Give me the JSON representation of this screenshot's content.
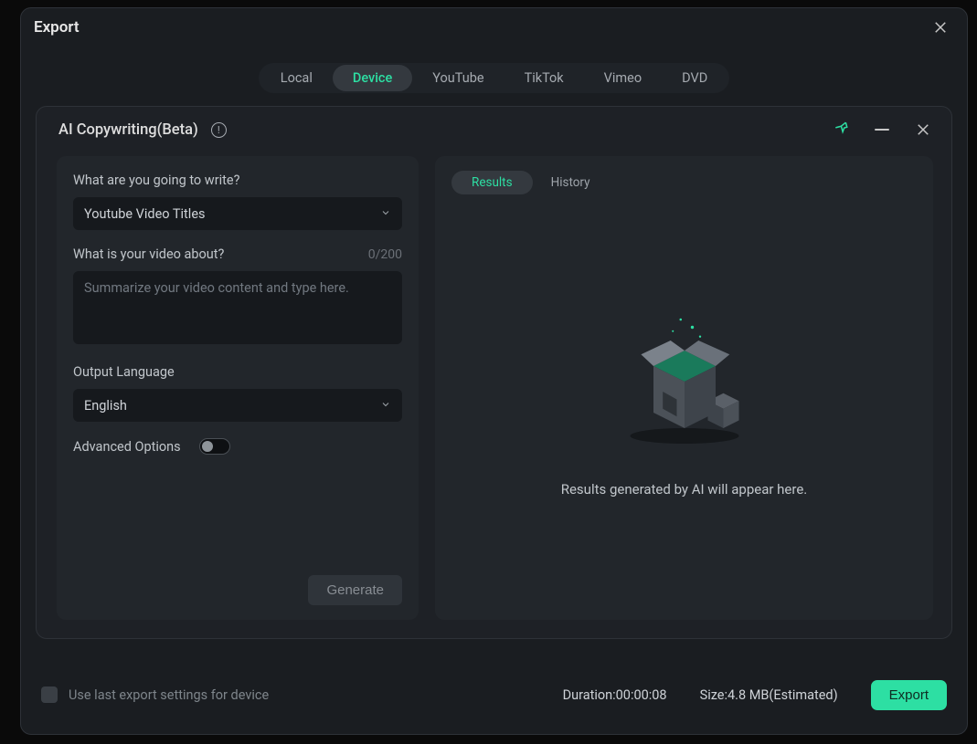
{
  "header": {
    "title": "Export"
  },
  "tabs": {
    "items": [
      "Local",
      "Device",
      "YouTube",
      "TikTok",
      "Vimeo",
      "DVD"
    ],
    "active": "Device"
  },
  "panel": {
    "title": "AI Copywriting(Beta)",
    "left": {
      "q_write": "What are you going to write?",
      "write_value": "Youtube Video Titles",
      "q_about": "What is your video about?",
      "about_count": "0/200",
      "about_placeholder": "Summarize your video content and type here.",
      "output_lang_label": "Output Language",
      "output_lang_value": "English",
      "advanced_label": "Advanced Options",
      "generate_label": "Generate"
    },
    "right": {
      "tab_results": "Results",
      "tab_history": "History",
      "empty_text": "Results generated by AI will appear here."
    }
  },
  "footer": {
    "use_last_label": "Use last export settings for device",
    "duration_label": "Duration:",
    "duration_value": "00:00:08",
    "size_label": "Size:",
    "size_value": "4.8 MB",
    "size_suffix": "(Estimated)",
    "export_label": "Export"
  }
}
